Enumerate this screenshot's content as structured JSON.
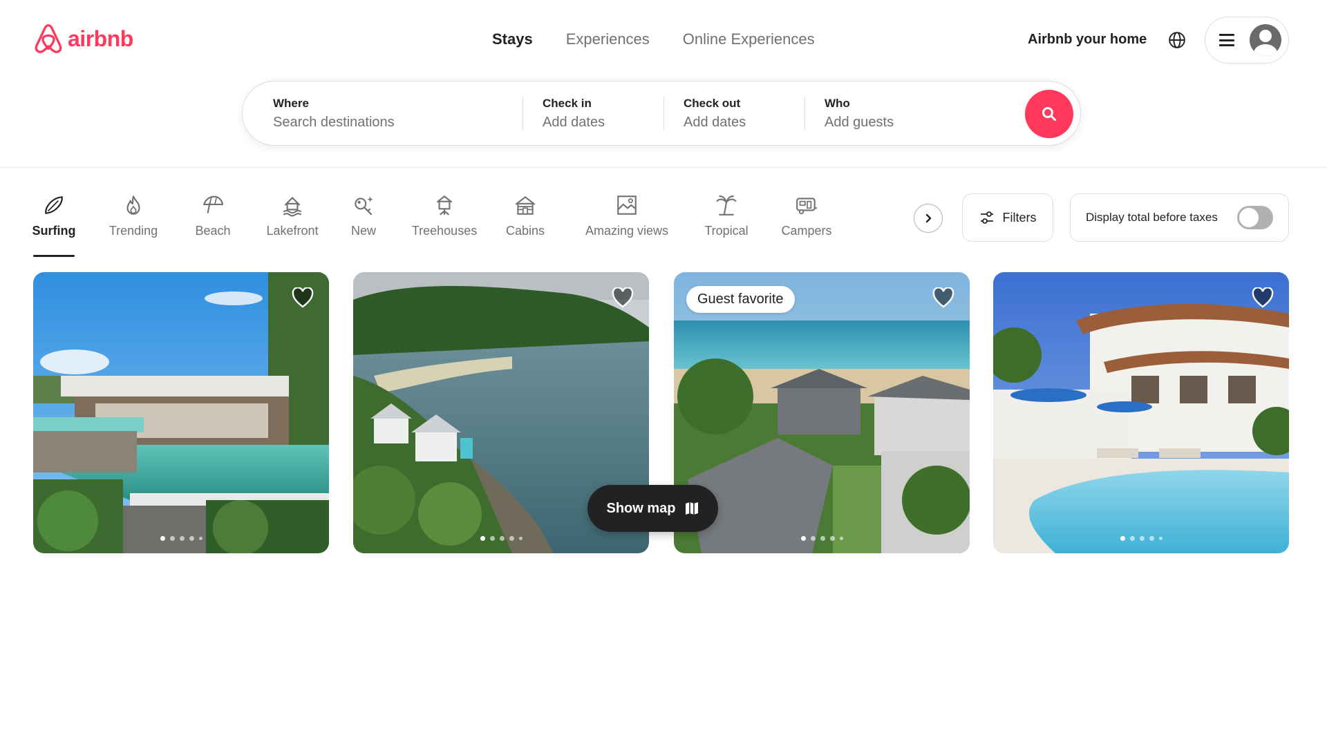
{
  "brand": {
    "name": "airbnb",
    "color": "#ff385c"
  },
  "nav": {
    "tabs": [
      "Stays",
      "Experiences",
      "Online Experiences"
    ],
    "active_tab": "Stays"
  },
  "header": {
    "host_link": "Airbnb your home",
    "globe_icon": "globe-icon",
    "menu_icon": "hamburger-icon",
    "avatar_icon": "user-avatar-icon"
  },
  "search": {
    "where_label": "Where",
    "where_placeholder": "Search destinations",
    "checkin_label": "Check in",
    "checkin_value": "Add dates",
    "checkout_label": "Check out",
    "checkout_value": "Add dates",
    "who_label": "Who",
    "who_value": "Add guests",
    "button_icon": "search-icon"
  },
  "categories": [
    {
      "label": "Surfing",
      "icon": "surfboard-icon",
      "active": true
    },
    {
      "label": "Trending",
      "icon": "flame-icon",
      "active": false
    },
    {
      "label": "Beach",
      "icon": "umbrella-icon",
      "active": false
    },
    {
      "label": "Lakefront",
      "icon": "lakefront-icon",
      "active": false
    },
    {
      "label": "New",
      "icon": "key-sparkle-icon",
      "active": false
    },
    {
      "label": "Treehouses",
      "icon": "treehouse-icon",
      "active": false
    },
    {
      "label": "Cabins",
      "icon": "cabin-icon",
      "active": false
    },
    {
      "label": "Amazing views",
      "icon": "view-icon",
      "active": false
    },
    {
      "label": "Tropical",
      "icon": "palm-tree-icon",
      "active": false
    },
    {
      "label": "Campers",
      "icon": "camper-icon",
      "active": false
    }
  ],
  "filters": {
    "label": "Filters",
    "icon": "sliders-icon"
  },
  "tax_toggle": {
    "label": "Display total before taxes",
    "enabled": false
  },
  "listings": [
    {
      "badge": "",
      "favorite_icon": "heart-icon",
      "photo_count_dots": 5,
      "active_dot": 1
    },
    {
      "badge": "",
      "favorite_icon": "heart-icon",
      "photo_count_dots": 5,
      "active_dot": 1
    },
    {
      "badge": "Guest favorite",
      "favorite_icon": "heart-icon",
      "photo_count_dots": 5,
      "active_dot": 1
    },
    {
      "badge": "",
      "favorite_icon": "heart-icon",
      "photo_count_dots": 5,
      "active_dot": 1
    }
  ],
  "map_button": {
    "label": "Show map",
    "icon": "map-icon"
  }
}
